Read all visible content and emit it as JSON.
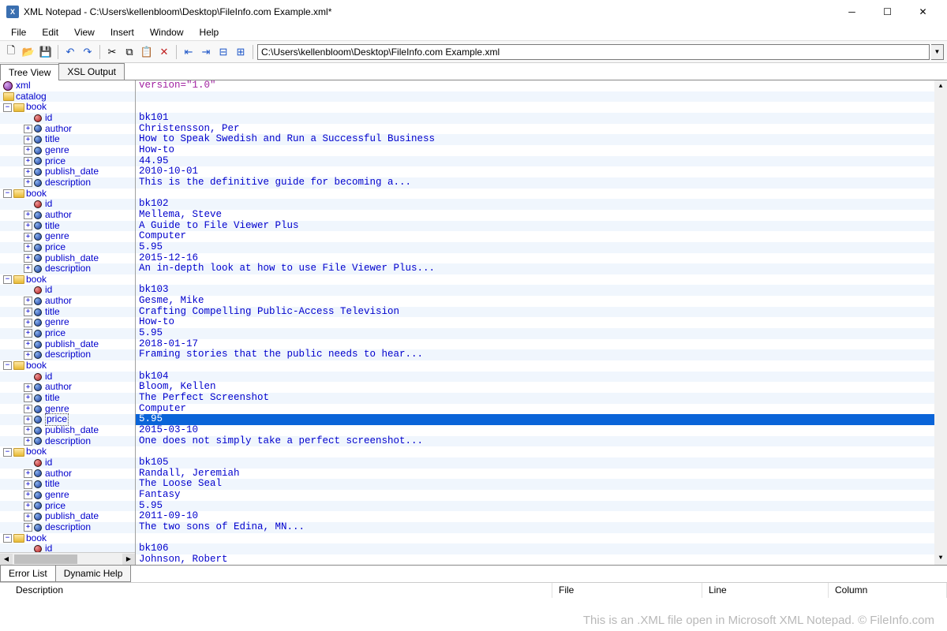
{
  "window": {
    "title": "XML Notepad - C:\\Users\\kellenbloom\\Desktop\\FileInfo.com Example.xml*",
    "app_icon_text": "X"
  },
  "menubar": [
    "File",
    "Edit",
    "View",
    "Insert",
    "Window",
    "Help"
  ],
  "toolbar": {
    "new_icon": "🗋",
    "open_icon": "📂",
    "save_icon": "💾",
    "undo_icon": "↶",
    "redo_icon": "↷",
    "cut_icon": "✂",
    "copy_icon": "⧉",
    "paste_icon": "📋",
    "delete_icon": "✕",
    "indent_left_icon": "⇤",
    "indent_right_icon": "⇥",
    "collapse_icon": "⊟",
    "expand_icon": "⊞",
    "address": "C:\\Users\\kellenbloom\\Desktop\\FileInfo.com Example.xml"
  },
  "main_tabs": {
    "tree_view": "Tree View",
    "xsl_output": "XSL Output"
  },
  "tree": {
    "root_xml": "xml",
    "root_catalog": "catalog",
    "book": "book",
    "fields": {
      "id": "id",
      "author": "author",
      "title": "title",
      "genre": "genre",
      "price": "price",
      "publish_date": "publish_date",
      "description": "description"
    }
  },
  "values": {
    "version": "version=\"1.0\"",
    "books": [
      {
        "id": "bk101",
        "author": "Christensson, Per",
        "title": "How to Speak Swedish and Run a Successful Business",
        "genre": "How-to",
        "price": "44.95",
        "publish_date": "2010-10-01",
        "description": "This is the definitive guide for becoming a..."
      },
      {
        "id": "bk102",
        "author": "Mellema, Steve",
        "title": "A Guide to File Viewer Plus",
        "genre": "Computer",
        "price": "5.95",
        "publish_date": "2015-12-16",
        "description": "An in-depth look at how to use File Viewer Plus..."
      },
      {
        "id": "bk103",
        "author": "Gesme, Mike",
        "title": "Crafting Compelling Public-Access Television",
        "genre": "How-to",
        "price": "5.95",
        "publish_date": "2018-01-17",
        "description": "Framing stories that the public needs to hear..."
      },
      {
        "id": "bk104",
        "author": "Bloom, Kellen",
        "title": "The Perfect Screenshot",
        "genre": "Computer",
        "price": "5.95",
        "publish_date": "2015-03-10",
        "description": "One does not simply take a perfect screenshot..."
      },
      {
        "id": "bk105",
        "author": "Randall, Jeremiah",
        "title": "The Loose Seal",
        "genre": "Fantasy",
        "price": "5.95",
        "publish_date": "2011-09-10",
        "description": "The two sons of Edina, MN..."
      },
      {
        "id": "bk106",
        "author": "Johnson, Robert"
      }
    ]
  },
  "selection": {
    "book_index": 3,
    "field": "price"
  },
  "bottom_tabs": {
    "error_list": "Error List",
    "dynamic_help": "Dynamic Help"
  },
  "error_grid": {
    "description": "Description",
    "file": "File",
    "line": "Line",
    "column": "Column"
  },
  "watermark": "This is an .XML file open in Microsoft XML Notepad. © FileInfo.com"
}
